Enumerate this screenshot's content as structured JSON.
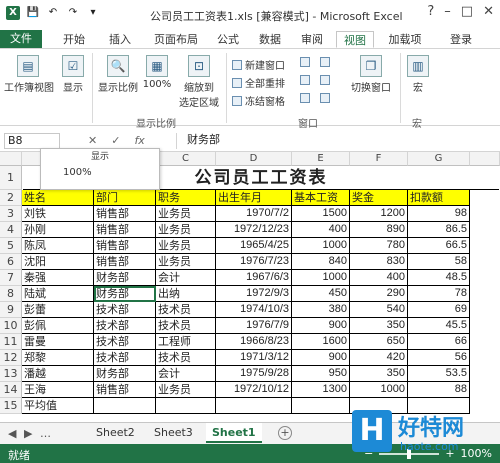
{
  "window": {
    "title": "公司员工工资表1.xls  [兼容模式] - Microsoft Excel",
    "app_letter": "X",
    "help": "?",
    "min": "–",
    "max": "□",
    "close": "✕"
  },
  "tabs": [
    "文件",
    "开始",
    "插入",
    "页面布局",
    "公式",
    "数据",
    "审阅",
    "视图",
    "加载项",
    "登录"
  ],
  "ribbon": {
    "workbook_views": "工作簿视图",
    "show": "显示",
    "zoom": "显示比例",
    "zoom_100": "100%",
    "zoom_sel1": "缩放到",
    "zoom_sel2": "选定区域",
    "new_window": "新建窗口",
    "arrange_all": "全部重排",
    "freeze": "冻结窗格",
    "switch_windows": "切换窗口",
    "macros": "宏",
    "group_zoom": "显示比例",
    "group_window": "窗口",
    "group_macros": "宏"
  },
  "formula_bar": {
    "name_box": "B8",
    "cancel": "✕",
    "enter": "✓",
    "fx": "fx",
    "content": "财务部"
  },
  "zoom_popup": {
    "label_top": "显示",
    "label_pct": "100%"
  },
  "columns": [
    "A",
    "B",
    "C",
    "D",
    "E",
    "F",
    "G"
  ],
  "rows": [
    "1",
    "2",
    "3",
    "4",
    "5",
    "6",
    "7",
    "8",
    "9",
    "10",
    "11",
    "12",
    "13",
    "14",
    "15"
  ],
  "sheet_title": "公司员工工资表",
  "table_header": [
    "姓名",
    "部门",
    "职务",
    "出生年月",
    "基本工资",
    "奖金",
    "扣款额"
  ],
  "table_rows": [
    [
      "刘铁",
      "销售部",
      "业务员",
      "1970/7/2",
      "1500",
      "1200",
      "98"
    ],
    [
      "孙刚",
      "销售部",
      "业务员",
      "1972/12/23",
      "400",
      "890",
      "86.5"
    ],
    [
      "陈凤",
      "销售部",
      "业务员",
      "1965/4/25",
      "1000",
      "780",
      "66.5"
    ],
    [
      "沈阳",
      "销售部",
      "业务员",
      "1976/7/23",
      "840",
      "830",
      "58"
    ],
    [
      "秦强",
      "财务部",
      "会计",
      "1967/6/3",
      "1000",
      "400",
      "48.5"
    ],
    [
      "陆斌",
      "财务部",
      "出纳",
      "1972/9/3",
      "450",
      "290",
      "78"
    ],
    [
      "彭蕾",
      "技术部",
      "技术员",
      "1974/10/3",
      "380",
      "540",
      "69"
    ],
    [
      "彭佩",
      "技术部",
      "技术员",
      "1976/7/9",
      "900",
      "350",
      "45.5"
    ],
    [
      "雷曼",
      "技术部",
      "工程师",
      "1966/8/23",
      "1600",
      "650",
      "66"
    ],
    [
      "郑黎",
      "技术部",
      "技术员",
      "1971/3/12",
      "900",
      "420",
      "56"
    ],
    [
      "潘越",
      "财务部",
      "会计",
      "1975/9/28",
      "950",
      "350",
      "53.5"
    ],
    [
      "王海",
      "销售部",
      "业务员",
      "1972/10/12",
      "1300",
      "1000",
      "88"
    ],
    [
      "平均值",
      "",
      "",
      "",
      "",
      "",
      ""
    ]
  ],
  "sheet_tabs": [
    "Sheet2",
    "Sheet3",
    "Sheet1"
  ],
  "status": {
    "ready": "就绪",
    "zoom_pct": "100%"
  },
  "watermark": {
    "letter": "H",
    "brand": "好特网",
    "url": "haote.com"
  },
  "colors": {
    "accent": "#217346",
    "header_fill": "#ffff00",
    "watermark": "#1d8ad6"
  }
}
